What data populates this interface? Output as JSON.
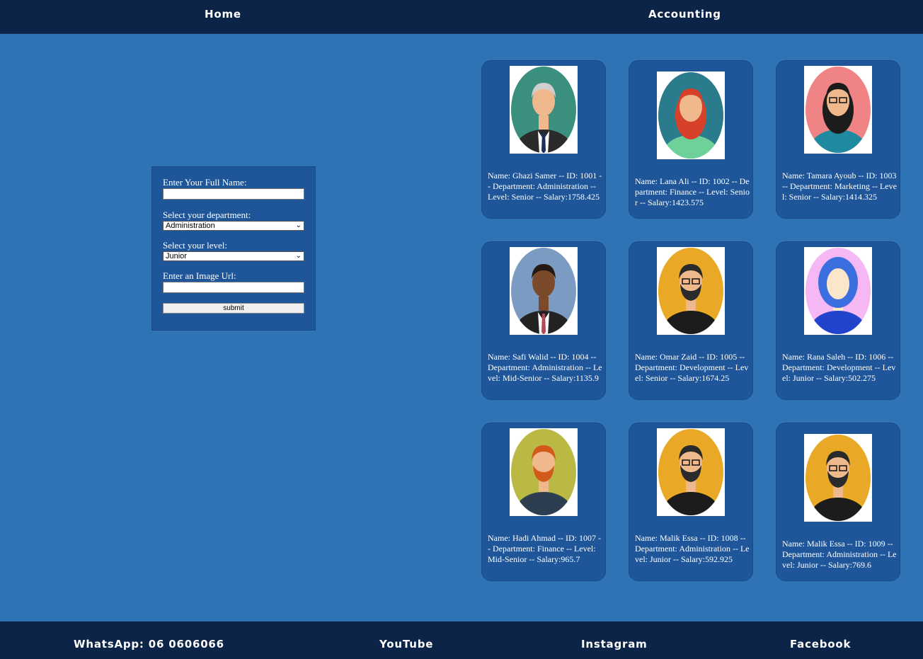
{
  "nav": {
    "home": "Home",
    "accounting": "Accounting"
  },
  "form": {
    "name_label": "Enter Your Full Name:",
    "name_value": "",
    "department_label": "Select your department:",
    "department_selected": "Administration",
    "level_label": "Select your level:",
    "level_selected": "Junior",
    "image_label": "Enter an Image Url:",
    "image_value": "",
    "submit_label": "submit"
  },
  "employees": [
    {
      "text": "Name: Ghazi Samer -- ID: 1001 -- Department: Administration -- Level: Senior -- Salary:1758.425",
      "avatar": "male-grey-hair-suit-avatar-icon",
      "bg": "#3a8f7f"
    },
    {
      "text": "Name: Lana Ali -- ID: 1002 -- Department: Finance -- Level: Senior -- Salary:1423.575",
      "avatar": "female-red-hair-avatar-icon",
      "bg": "#2a7c8c"
    },
    {
      "text": "Name: Tamara Ayoub -- ID: 1003 -- Department: Marketing -- Level: Senior -- Salary:1414.325",
      "avatar": "female-glasses-black-hair-avatar-icon",
      "bg": "#f08383"
    },
    {
      "text": "Name: Safi Walid -- ID: 1004 -- Department: Administration -- Level: Mid-Senior -- Salary:1135.9",
      "avatar": "male-dark-skin-suit-avatar-icon",
      "bg": "#7b9bc2"
    },
    {
      "text": "Name: Omar Zaid -- ID: 1005 -- Department: Development -- Level: Senior -- Salary:1674.25",
      "avatar": "male-beard-glasses-avatar-icon",
      "bg": "#e9a825"
    },
    {
      "text": "Name: Rana Saleh -- ID: 1006 -- Department: Development -- Level: Junior -- Salary:502.275",
      "avatar": "female-hijab-avatar-icon",
      "bg": "#f5b8f5"
    },
    {
      "text": "Name: Hadi Ahmad -- ID: 1007 -- Department: Finance -- Level: Mid-Senior -- Salary:965.7",
      "avatar": "male-red-beard-avatar-icon",
      "bg": "#b9b944"
    },
    {
      "text": "Name: Malik Essa -- ID: 1008 -- Department: Administration -- Level: Junior -- Salary:592.925",
      "avatar": "male-beard-glasses-avatar-icon",
      "bg": "#e9a825"
    },
    {
      "text": "Name: Malik Essa -- ID: 1009 -- Department: Administration -- Level: Junior -- Salary:769.6",
      "avatar": "male-beard-glasses-avatar-icon",
      "bg": "#e9a825"
    }
  ],
  "footer": {
    "whatsapp": "WhatsApp: 06 0606066",
    "youtube": "YouTube",
    "instagram": "Instagram",
    "facebook": "Facebook"
  }
}
